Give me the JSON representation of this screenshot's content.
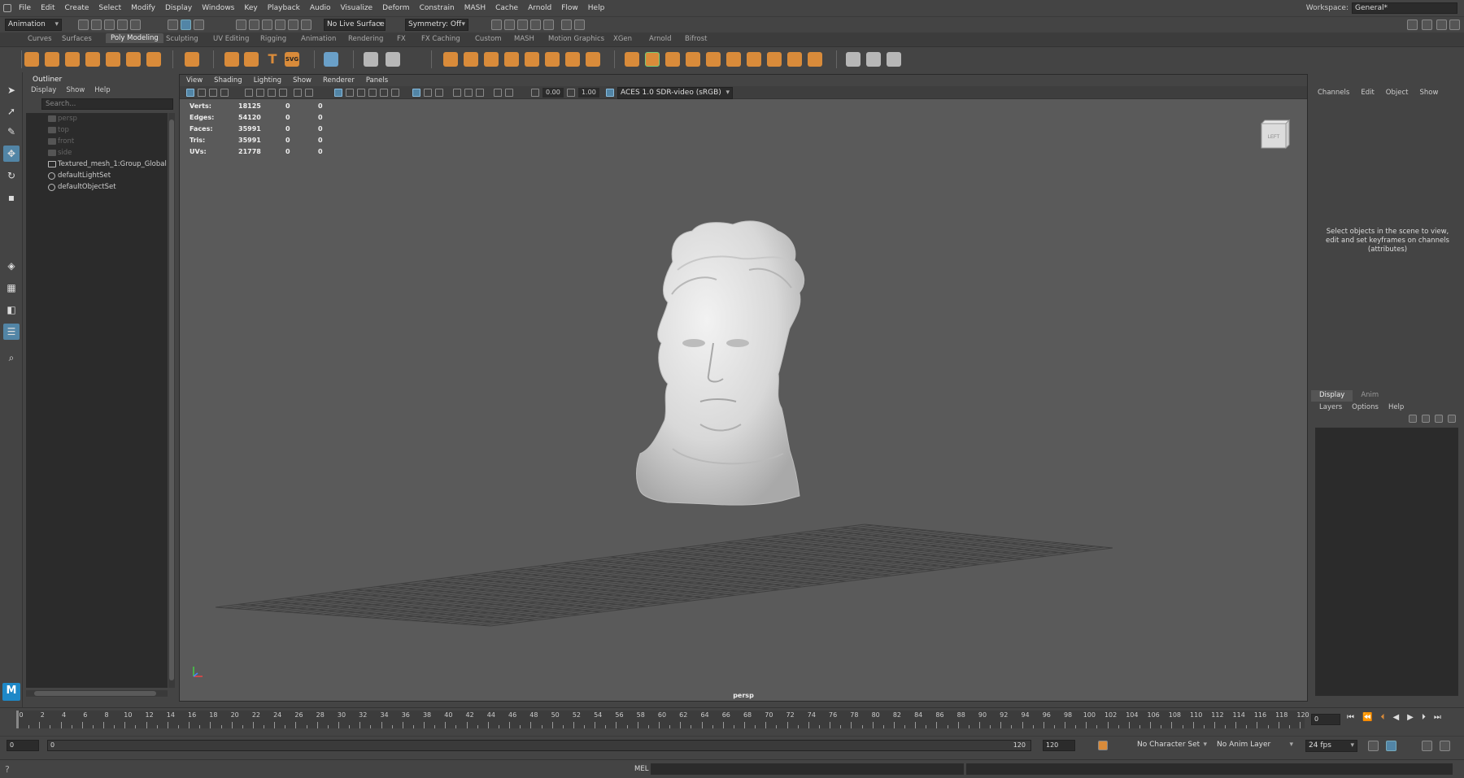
{
  "menubar": {
    "items": [
      "File",
      "Edit",
      "Create",
      "Select",
      "Modify",
      "Display",
      "Windows",
      "Key",
      "Playback",
      "Audio",
      "Visualize",
      "Deform",
      "Constrain",
      "MASH",
      "Cache",
      "Arnold",
      "Flow",
      "Help"
    ],
    "workspace_label": "Workspace:",
    "workspace_value": "General*"
  },
  "statusline": {
    "menuset": "Animation",
    "live_surface": "No Live Surface",
    "symmetry": "Symmetry: Off"
  },
  "shelf_tabs": [
    "Curves",
    "Surfaces",
    "Poly Modeling",
    "Sculpting",
    "UV Editing",
    "Rigging",
    "Animation",
    "Rendering",
    "FX",
    "FX Caching",
    "Custom",
    "MASH",
    "Motion Graphics",
    "XGen",
    "Arnold",
    "Bifrost"
  ],
  "shelf_active_tab": "Poly Modeling",
  "shelf_svg_label": "SVG",
  "shelf_text_label": "T",
  "outliner": {
    "title": "Outliner",
    "menus": [
      "Display",
      "Show",
      "Help"
    ],
    "search_placeholder": "Search...",
    "items": [
      {
        "label": "persp",
        "dim": true,
        "kind": "camera"
      },
      {
        "label": "top",
        "dim": true,
        "kind": "camera"
      },
      {
        "label": "front",
        "dim": true,
        "kind": "camera"
      },
      {
        "label": "side",
        "dim": true,
        "kind": "camera"
      },
      {
        "label": "Textured_mesh_1:Group_Global",
        "dim": false,
        "kind": "group"
      },
      {
        "label": "defaultLightSet",
        "dim": false,
        "kind": "set"
      },
      {
        "label": "defaultObjectSet",
        "dim": false,
        "kind": "set"
      }
    ]
  },
  "viewport": {
    "menus": [
      "View",
      "Shading",
      "Lighting",
      "Show",
      "Renderer",
      "Panels"
    ],
    "exposure": "0.00",
    "gamma": "1.00",
    "color_space": "ACES 1.0 SDR-video (sRGB)",
    "hud": [
      {
        "label": "Verts:",
        "a": "18125",
        "b": "0",
        "c": "0"
      },
      {
        "label": "Edges:",
        "a": "54120",
        "b": "0",
        "c": "0"
      },
      {
        "label": "Faces:",
        "a": "35991",
        "b": "0",
        "c": "0"
      },
      {
        "label": "Tris:",
        "a": "35991",
        "b": "0",
        "c": "0"
      },
      {
        "label": "UVs:",
        "a": "21778",
        "b": "0",
        "c": "0"
      }
    ],
    "viewcube_label": "LEFT",
    "camera": "persp"
  },
  "channelbox": {
    "menus": [
      "Channels",
      "Edit",
      "Object",
      "Show"
    ],
    "message": "Select objects in the scene to view, edit and set keyframes on channels (attributes)"
  },
  "layers": {
    "tabs": [
      "Display",
      "Anim"
    ],
    "active_tab": "Display",
    "menus": [
      "Layers",
      "Options",
      "Help"
    ]
  },
  "timeslider": {
    "labels": [
      0,
      2,
      4,
      6,
      8,
      10,
      12,
      14,
      16,
      18,
      20,
      22,
      24,
      26,
      28,
      30,
      32,
      34,
      36,
      38,
      40,
      42,
      44,
      46,
      48,
      50,
      52,
      54,
      56,
      58,
      60,
      62,
      64,
      66,
      68,
      70,
      72,
      74,
      76,
      78,
      80,
      82,
      84,
      86,
      88,
      90,
      92,
      94,
      96,
      98,
      100,
      102,
      104,
      106,
      108,
      110,
      112,
      114,
      116,
      118,
      120
    ],
    "current_frame": "0",
    "current_frame_field": "0"
  },
  "rangeslider": {
    "start": "0",
    "inner_start": "0",
    "inner_end": "120",
    "end": "120",
    "character_set": "No Character Set",
    "anim_layer": "No Anim Layer",
    "fps": "24 fps"
  },
  "cmdline": {
    "lang": "MEL"
  },
  "colors": {
    "accent": "#5285a6",
    "shelf_orange": "#d98b3a",
    "maya_blue": "#1e88c7"
  }
}
